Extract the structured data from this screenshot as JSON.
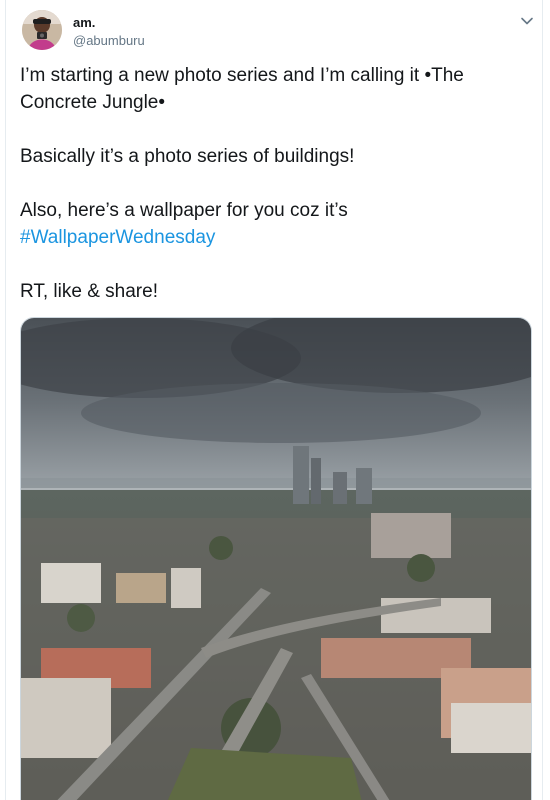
{
  "user": {
    "display_name": "am.",
    "handle": "@abumburu",
    "avatar_icon": "profile-photo"
  },
  "menu": {
    "icon": "chevron-down-icon"
  },
  "tweet": {
    "line1": "I’m starting a new photo series and I’m calling it •The Concrete Jungle•",
    "line2": "Basically it’s a photo series of buildings!",
    "line3_prefix": "Also, here’s a wallpaper for you coz it’s",
    "hashtag": "#WallpaperWednesday",
    "line4": "RT, like & share!"
  },
  "media": {
    "type": "photo"
  },
  "colors": {
    "text": "#14171a",
    "secondary": "#657786",
    "link": "#1b95e0",
    "border": "#e6ecf0"
  }
}
